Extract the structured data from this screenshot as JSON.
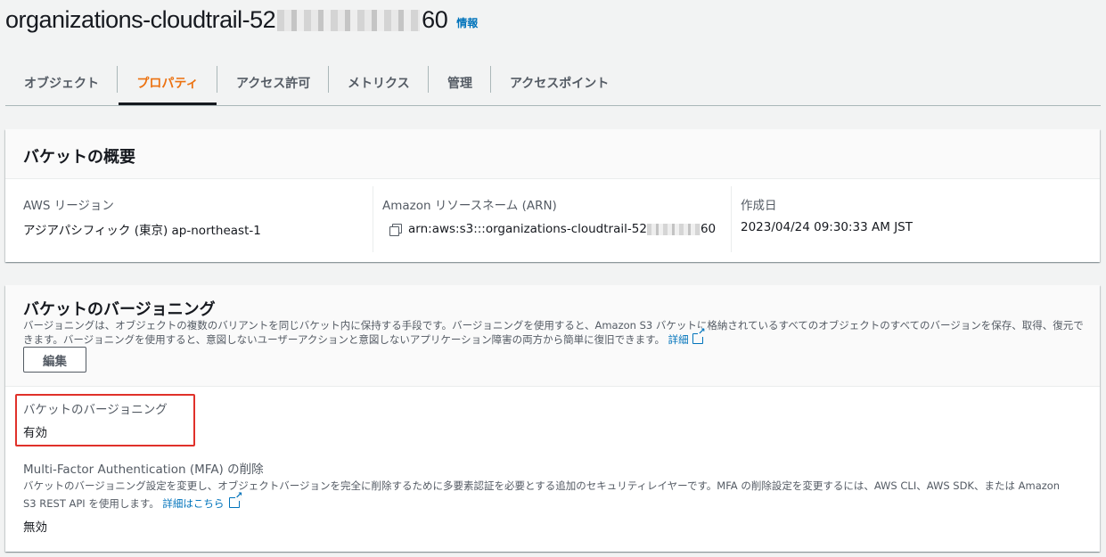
{
  "header": {
    "bucket_name_start": "organizations-cloudtrail-52",
    "bucket_name_end": "60",
    "info_link": "情報"
  },
  "tabs": [
    {
      "label": "オブジェクト",
      "active": false
    },
    {
      "label": "プロパティ",
      "active": true
    },
    {
      "label": "アクセス許可",
      "active": false
    },
    {
      "label": "メトリクス",
      "active": false
    },
    {
      "label": "管理",
      "active": false
    },
    {
      "label": "アクセスポイント",
      "active": false
    }
  ],
  "overview": {
    "title": "バケットの概要",
    "region_label": "AWS リージョン",
    "region_value": "アジアパシフィック (東京) ap-northeast-1",
    "arn_label": "Amazon リソースネーム (ARN)",
    "arn_value_start": "arn:aws:s3:::organizations-cloudtrail-52",
    "arn_value_end": "60",
    "created_label": "作成日",
    "created_value": "2023/04/24 09:30:33 AM JST"
  },
  "versioning": {
    "title": "バケットのバージョニング",
    "description": "バージョニングは、オブジェクトの複数のバリアントを同じバケット内に保持する手段です。バージョニングを使用すると、Amazon S3 バケットに格納されているすべてのオブジェクトのすべてのバージョンを保存、取得、復元できます。バージョニングを使用すると、意図しないユーザーアクションと意図しないアプリケーション障害の両方から簡単に復旧できます。",
    "details_link": "詳細",
    "edit_button": "編集",
    "status_label": "バケットのバージョニング",
    "status_value": "有効",
    "mfa_label": "Multi-Factor Authentication (MFA) の削除",
    "mfa_description": "バケットのバージョニング設定を変更し、オブジェクトバージョンを完全に削除するために多要素認証を必要とする追加のセキュリティレイヤーです。MFA の削除設定を変更するには、AWS CLI、AWS SDK、または Amazon S3 REST API を使用します。",
    "mfa_details_link": "詳細はこちら",
    "mfa_value": "無効"
  },
  "colors": {
    "active_tab": "#ec7211",
    "link": "#0073bb",
    "highlight_border": "#e0312a"
  }
}
